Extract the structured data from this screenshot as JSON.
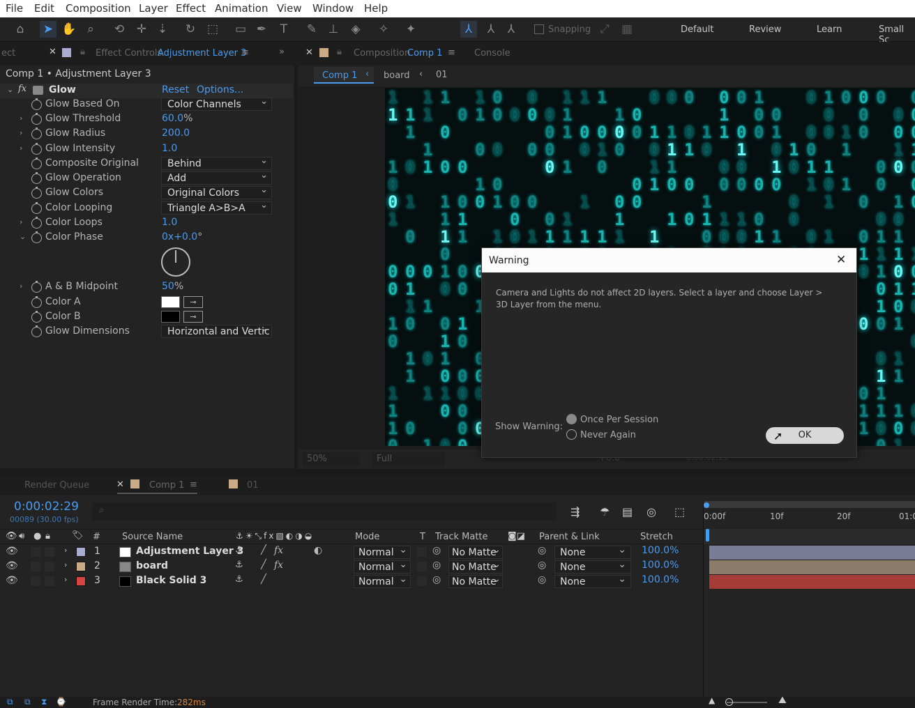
{
  "menu": [
    "File",
    "Edit",
    "Composition",
    "Layer",
    "Effect",
    "Animation",
    "View",
    "Window",
    "Help"
  ],
  "toolbar": {
    "snapping": "Snapping",
    "workspaces": [
      "Default",
      "Review",
      "Learn",
      "Small Sc"
    ]
  },
  "effect_panel": {
    "left_tab": "ect",
    "tab_label": "Effect Controls",
    "tab_layer": "Adjustment Layer 3",
    "breadcrumb": "Comp 1 • Adjustment Layer 3",
    "effect_name": "Glow",
    "reset": "Reset",
    "options": "Options...",
    "props": [
      {
        "label": "Glow Based On",
        "dropdown": "Color Channels"
      },
      {
        "label": "Glow Threshold",
        "value": "60.0",
        "unit": "%"
      },
      {
        "label": "Glow Radius",
        "value": "200.0"
      },
      {
        "label": "Glow Intensity",
        "value": "1.0"
      },
      {
        "label": "Composite Original",
        "dropdown": "Behind"
      },
      {
        "label": "Glow Operation",
        "dropdown": "Add"
      },
      {
        "label": "Glow Colors",
        "dropdown": "Original Colors"
      },
      {
        "label": "Color Looping",
        "dropdown": "Triangle A>B>A"
      },
      {
        "label": "Color Loops",
        "value": "1.0"
      },
      {
        "label": "Color Phase",
        "value": "0x+0.0",
        "unit": "°"
      },
      {
        "label": "A & B Midpoint",
        "value": "50",
        "unit": "%"
      },
      {
        "label": "Color A"
      },
      {
        "label": "Color B"
      },
      {
        "label": "Glow Dimensions",
        "dropdown": "Horizontal and Vertic"
      }
    ]
  },
  "comp_panel": {
    "tab_label": "Composition",
    "tab_comp": "Comp 1",
    "console": "Console",
    "flow": [
      "Comp 1",
      "board",
      "01"
    ],
    "zoom": "50%",
    "resolution": "Full",
    "exposure": "+0.0",
    "time": "0:00:02:29"
  },
  "dialog": {
    "title": "Warning",
    "message": "Camera and Lights do not affect 2D layers.  Select a layer and choose Layer > 3D Layer from the menu.",
    "show_warning": "Show Warning:",
    "options": [
      "Once Per Session",
      "Never Again"
    ],
    "ok": "OK"
  },
  "timeline": {
    "tabs": [
      "Render Queue",
      "Comp 1",
      "01"
    ],
    "timecode": "0:00:02:29",
    "frame_info": "00089 (30.00 fps)",
    "columns": {
      "num": "#",
      "source": "Source Name",
      "mode": "Mode",
      "t": "T",
      "track_matte": "Track Matte",
      "parent": "Parent & Link",
      "stretch": "Stretch"
    },
    "ruler": [
      "0:00f",
      "10f",
      "20f",
      "01:0"
    ],
    "layers": [
      {
        "num": "1",
        "name": "Adjustment Layer 3",
        "label_color": "#a9acd2",
        "swatch": "#ffffff",
        "mode": "Normal",
        "matte": "No Matte",
        "parent": "None",
        "stretch": "100.0%",
        "bar": "#7a7b95"
      },
      {
        "num": "2",
        "name": "board",
        "label_color": "#c9ac87",
        "swatch": "#888888",
        "mode": "Normal",
        "matte": "No Matte",
        "parent": "None",
        "stretch": "100.0%",
        "bar": "#8c7d6a"
      },
      {
        "num": "3",
        "name": "Black Solid 3",
        "label_color": "#d64541",
        "swatch": "#000000",
        "mode": "Normal",
        "matte": "No Matte",
        "parent": "None",
        "stretch": "100.0%",
        "bar": "#a53c37"
      }
    ],
    "render_label": "Frame Render Time:",
    "render_value": "282ms"
  }
}
